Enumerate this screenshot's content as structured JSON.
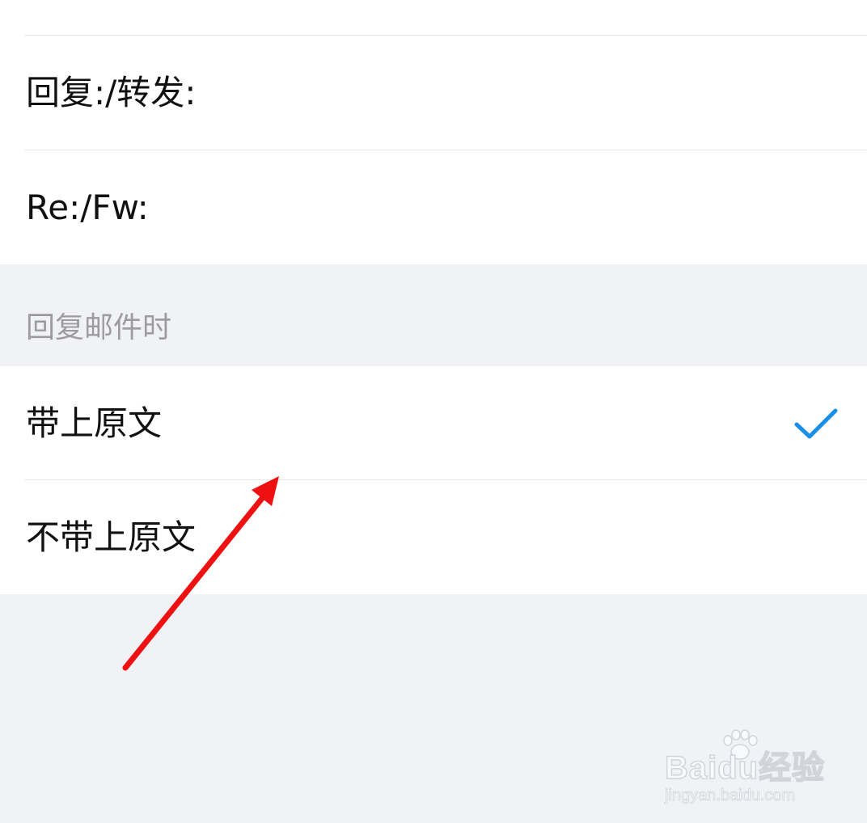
{
  "prefix_options": [
    {
      "label": "回复:/转发:"
    },
    {
      "label": "Re:/Fw:"
    }
  ],
  "reply_section": {
    "header": "回复邮件时",
    "options": [
      {
        "label": "带上原文",
        "selected": true
      },
      {
        "label": "不带上原文",
        "selected": false
      }
    ]
  },
  "check_icon": "checkmark-icon",
  "accent_color": "#1a8fe8",
  "annotation": {
    "arrow_color": "#ee1111"
  },
  "watermark": {
    "logo": "Baidu经验",
    "url": "jingyan.baidu.com"
  }
}
